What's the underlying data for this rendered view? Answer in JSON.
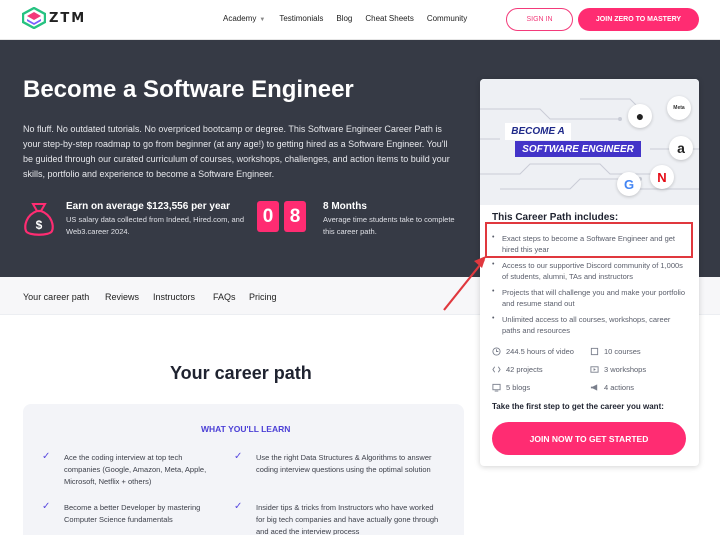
{
  "nav": {
    "logo_text": "ZTM",
    "links": [
      "Academy",
      "Testimonials",
      "Blog",
      "Cheat Sheets",
      "Community"
    ],
    "signin": "SIGN IN",
    "join": "JOIN ZERO TO MASTERY"
  },
  "hero": {
    "title": "Become a Software Engineer",
    "description": "No fluff. No outdated tutorials. No overpriced bootcamp or degree. This Software Engineer Career Path is your step-by-step roadmap to go from beginner (at any age!) to getting hired as a Software Engineer. You'll be guided through our curated curriculum of courses, workshops, challenges, and action items to build your skills, portfolio and experience to become a Software Engineer.",
    "earn_title": "Earn on average $123,556 per year",
    "earn_sub": "US salary data collected from Indeed, Hired.com, and Web3.career 2024.",
    "digits": [
      "0",
      "8"
    ],
    "months_title": "8 Months",
    "months_sub": "Average time students take to complete this career path."
  },
  "tabs": [
    "Your career path",
    "Reviews",
    "Instructors",
    "FAQs",
    "Pricing"
  ],
  "career": {
    "title": "Your career path",
    "learn_heading": "WHAT YOU'LL LEARN",
    "items": [
      "Ace the coding interview at top tech companies (Google, Amazon, Meta, Apple, Microsoft, Netflix + others)",
      "Use the right Data Structures & Algorithms to answer coding interview questions using the optimal solution",
      "Become a better Developer by mastering Computer Science fundamentals",
      "Insider tips & tricks from Instructors who have worked for big tech companies and have actually gone through and aced the interview process"
    ]
  },
  "card": {
    "badge_line1": "BECOME A",
    "badge_line2": "SOFTWARE ENGINEER",
    "logos": [
      "Meta",
      "",
      "a",
      "G",
      "N"
    ],
    "includes_title": "This Career Path includes:",
    "includes": [
      "Exact steps to become a Software Engineer and get hired this year",
      "Access to our supportive Discord community of 1,000s of students, alumni, TAs and instructors",
      "Projects that will challenge you and make your portfolio and resume stand out",
      "Unlimited access to all courses, workshops, career paths and resources"
    ],
    "stats": [
      {
        "text": "244.5 hours of video",
        "icon": "clock-icon"
      },
      {
        "text": "10 courses",
        "icon": "book-icon"
      },
      {
        "text": "42 projects",
        "icon": "code-icon"
      },
      {
        "text": "3 workshops",
        "icon": "play-icon"
      },
      {
        "text": "5 blogs",
        "icon": "blog-icon"
      },
      {
        "text": "4 actions",
        "icon": "megaphone-icon"
      }
    ],
    "cta_text": "Take the first step to get the career you want:",
    "cta_button": "JOIN NOW TO GET STARTED"
  },
  "colors": {
    "accent": "#ff2c72",
    "hero_bg": "#363a45",
    "purple": "#4b3fd6",
    "highlight_box": "#e0383e"
  }
}
